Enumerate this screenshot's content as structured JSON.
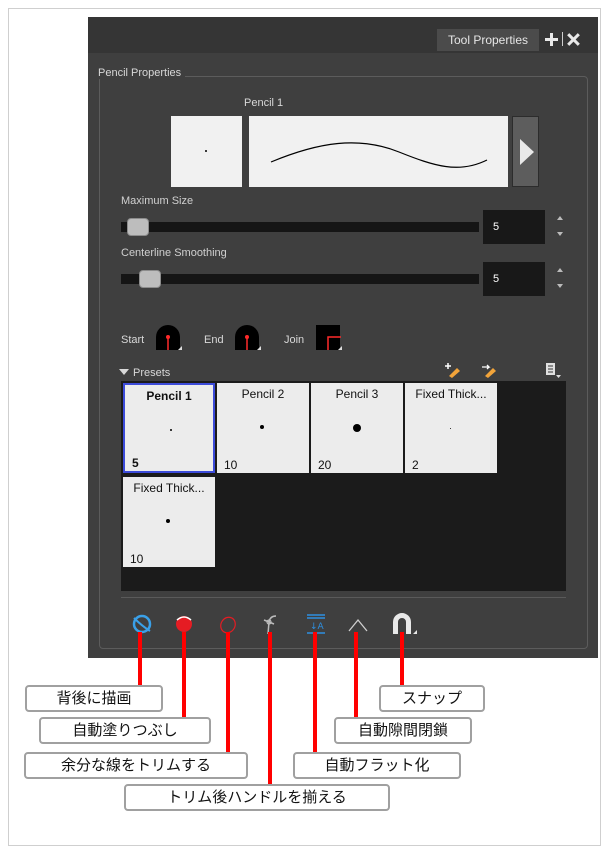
{
  "panel": {
    "tab_title": "Tool Properties",
    "group_title": "Pencil Properties",
    "current_preset": "Pencil 1",
    "maximum_size": {
      "label": "Maximum Size",
      "value": "5",
      "slider_fraction": 0.05
    },
    "centerline_smoothing": {
      "label": "Centerline Smoothing",
      "value": "5",
      "slider_fraction": 0.08
    },
    "caps": {
      "start_label": "Start",
      "end_label": "End",
      "join_label": "Join"
    },
    "presets": {
      "header": "Presets",
      "items": [
        {
          "name": "Pencil 1",
          "size": "5",
          "selected": true
        },
        {
          "name": "Pencil 2",
          "size": "10",
          "selected": false
        },
        {
          "name": "Pencil 3",
          "size": "20",
          "selected": false
        },
        {
          "name": "Fixed Thick...",
          "size": "2",
          "selected": false
        },
        {
          "name": "Fixed Thick...",
          "size": "10",
          "selected": false
        }
      ]
    }
  },
  "callouts": {
    "draw_behind": "背後に描画",
    "auto_fill": "自動塗りつぶし",
    "trim_extra": "余分な線をトリムする",
    "align_handles": "トリム後ハンドルを揃える",
    "auto_flatten": "自動フラット化",
    "auto_close_gap": "自動隙間閉鎖",
    "snap": "スナップ"
  },
  "colors": {
    "panel_bg": "#3f3f3f",
    "selection_border": "#3c4bd9",
    "leader_line": "#ff0000"
  }
}
